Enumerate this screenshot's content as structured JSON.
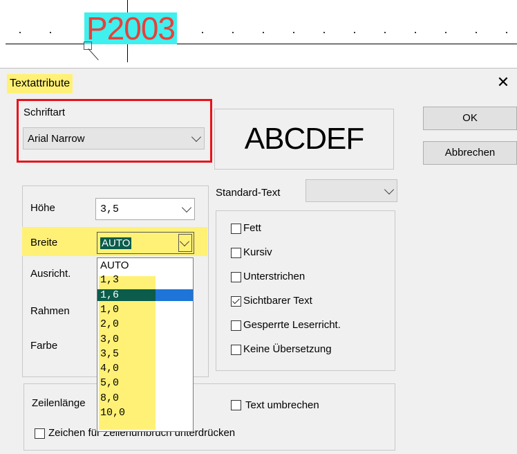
{
  "cad": {
    "label": "P2003"
  },
  "dialog": {
    "title": "Textattribute",
    "close_symbol": "✕",
    "ok_label": "OK",
    "cancel_label": "Abbrechen",
    "font_group": {
      "label": "Schriftart",
      "value": "Arial Narrow"
    },
    "preview_text": "ABCDEF",
    "standard_text": {
      "label": "Standard-Text",
      "value": ""
    },
    "fields": {
      "hoehe": {
        "label": "Höhe",
        "value": "3,5"
      },
      "breite": {
        "label": "Breite",
        "value": "AUTO"
      },
      "ausricht": {
        "label": "Ausricht."
      },
      "rahmen": {
        "label": "Rahmen"
      },
      "farbe": {
        "label": "Farbe"
      }
    },
    "breite_options": [
      "AUTO",
      "1,3",
      "1,6",
      "1,0",
      "2,0",
      "3,0",
      "3,5",
      "4,0",
      "5,0",
      "8,0",
      "10,0"
    ],
    "breite_highlighted_option": "1,6",
    "checkboxes": [
      {
        "label": "Fett",
        "checked": false
      },
      {
        "label": "Kursiv",
        "checked": false
      },
      {
        "label": "Unterstrichen",
        "checked": false
      },
      {
        "label": "Sichtbarer Text",
        "checked": true
      },
      {
        "label": "Gesperrte Leserricht.",
        "checked": false
      },
      {
        "label": "Keine Übersetzung",
        "checked": false
      }
    ],
    "zeilen": {
      "length_label": "Zeilenlänge",
      "wrap_label": "Text umbrechen",
      "wrap_checked": false,
      "suppress_label": "Zeichen für Zeilenumbruch unterdrücken",
      "suppress_checked": false
    }
  },
  "colors": {
    "highlight_yellow": "#fff176",
    "highlight_red": "#e8121b",
    "cad_text": "#e8403a",
    "cad_highlight": "#3ff0ee",
    "selected_item": "#0b5c4b"
  }
}
